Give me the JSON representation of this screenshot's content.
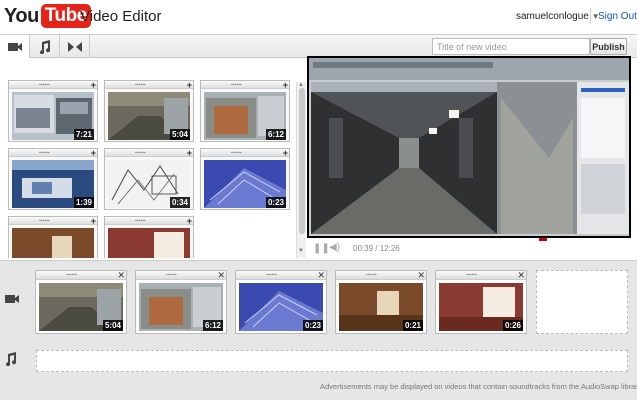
{
  "header": {
    "logo_you": "You",
    "logo_tube": "Tube",
    "app_title": "Video Editor",
    "username": "samuelconlogue",
    "signout": "Sign Out"
  },
  "toolbar": {
    "tabs": [
      {
        "name": "video-camera-icon",
        "active": true
      },
      {
        "name": "music-note-icon",
        "active": false
      },
      {
        "name": "transition-icon",
        "active": false
      }
    ],
    "title_placeholder": "Title of new video",
    "publish_label": "Publish"
  },
  "library": {
    "clips": [
      {
        "duration": "7:21",
        "scene": "desk"
      },
      {
        "duration": "5:04",
        "scene": "corridor"
      },
      {
        "duration": "6:12",
        "scene": "building"
      },
      {
        "duration": "1:39",
        "scene": "blueprint"
      },
      {
        "duration": "0:34",
        "scene": "sketch"
      },
      {
        "duration": "0:23",
        "scene": "bluebuilding"
      },
      {
        "duration": "",
        "scene": "room"
      },
      {
        "duration": "",
        "scene": "room2"
      }
    ]
  },
  "player": {
    "time": "00:39 / 12:26"
  },
  "timeline": {
    "clips": [
      {
        "duration": "5:04",
        "scene": "corridor"
      },
      {
        "duration": "6:12",
        "scene": "building"
      },
      {
        "duration": "0:23",
        "scene": "bluebuilding"
      },
      {
        "duration": "0:21",
        "scene": "room"
      },
      {
        "duration": "0:26",
        "scene": "room2"
      }
    ],
    "ad_note": "Advertisements may be displayed on videos that contain soundtracks from the AudioSwap library"
  },
  "colors": {
    "brand_red": "#e62117",
    "link_blue": "#1155cc",
    "timeline_bg": "#e6e6e6"
  }
}
